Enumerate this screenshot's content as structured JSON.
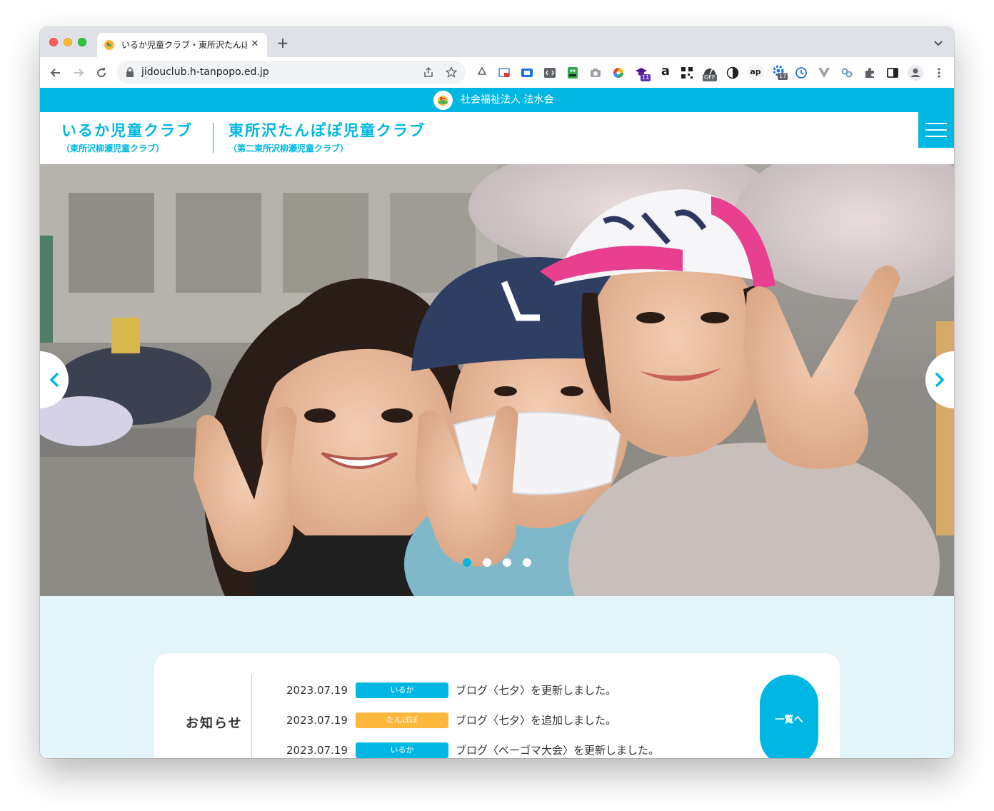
{
  "browser": {
    "tab_title": "いるか児童クラブ・東所沢たんぽぽ児童クラブ",
    "tab_close": "✕",
    "new_tab": "+",
    "url": "jidouclub.h-tanpopo.ed.jp",
    "extension_badges": [
      "11",
      "OFF",
      "17"
    ],
    "extension_letters": [
      "a",
      "ap"
    ]
  },
  "site": {
    "corp_name": "社会福祉法人 法水会",
    "club1": {
      "name": "いるか児童クラブ",
      "sub": "（東所沢柳瀬児童クラブ）"
    },
    "club2": {
      "name": "東所沢たんぽぽ児童クラブ",
      "sub": "（第二東所沢柳瀬児童クラブ）"
    }
  },
  "slider": {
    "slides": 4,
    "active_slide": 1,
    "hero_image": "photo of three smiling children making peace signs"
  },
  "news": {
    "heading": "お知らせ",
    "more_label": "一覧へ",
    "items": [
      {
        "date": "2023.07.19",
        "tag": "いるか",
        "tag_color": "#00b7e3",
        "text": "ブログ〈七夕〉を更新しました。"
      },
      {
        "date": "2023.07.19",
        "tag": "たんぽぽ",
        "tag_color": "#fbb83d",
        "text": "ブログ〈七夕〉を追加しました。"
      },
      {
        "date": "2023.07.19",
        "tag": "いるか",
        "tag_color": "#00b7e3",
        "text": "ブログ〈ベーゴマ大会〉を更新しました。"
      }
    ]
  },
  "colors": {
    "brand": "#00b7e3",
    "tanpopo": "#fbb83d",
    "section_bg": "#e3f4fa"
  }
}
